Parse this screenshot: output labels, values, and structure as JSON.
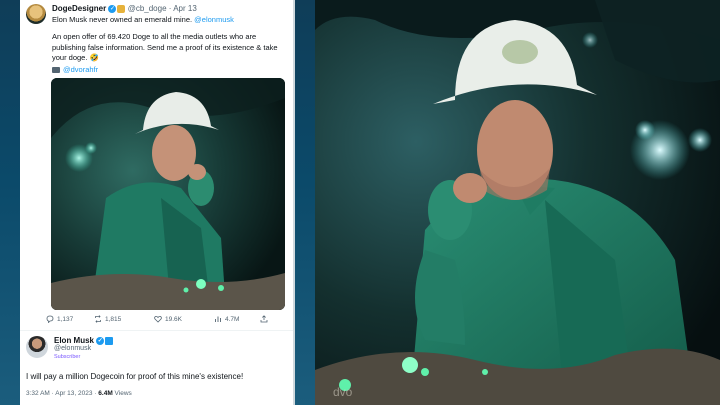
{
  "tweet1": {
    "display_name": "DogeDesigner",
    "handle": "@cb_doge",
    "separator": "·",
    "date": "Apr 13",
    "headline": "Elon Musk never owned an emerald mine.",
    "mention": "@elonmusk",
    "body": "An open offer of 69.420 Doge to all the media outlets who are publishing false information. Send me a proof of its existence & take your doge. 🤣",
    "image_credit": "@dvorahfr",
    "metrics": {
      "replies": "1,137",
      "retweets": "1,815",
      "likes": "19.6K",
      "views": "4.7M"
    }
  },
  "tweet2": {
    "display_name": "Elon Musk",
    "handle": "@elonmusk",
    "subscriber_label": "Subscriber",
    "body": "I will pay a million Dogecoin for proof of this mine's existence!",
    "timestamp": "3:32 AM · Apr 13, 2023 ·",
    "views_count": "6.4M",
    "views_label": "Views"
  },
  "icons": {
    "verified": "verified-check-icon",
    "org_badge": "gold-badge-icon",
    "photo": "camera-icon",
    "reply": "reply-icon",
    "retweet": "retweet-icon",
    "like": "heart-icon",
    "views": "chart-icon",
    "share": "share-icon"
  },
  "colors": {
    "link": "#1d9bf0",
    "text": "#0f1419",
    "muted": "#536471",
    "subscriber": "#7856ff",
    "emerald": "#38e8a0"
  },
  "photo_signature": "dvo"
}
